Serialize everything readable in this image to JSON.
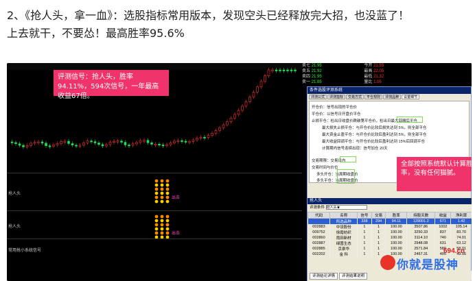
{
  "article": {
    "line1": "2、《抢人头，拿一血》：选股指标常用版本，发现空头已经释放完大招，也没蓝了！",
    "line2": "上去就干，不要怂！最高胜率95.6%"
  },
  "callouts": {
    "top": "评测信号：抢人头，胜率94.11%，594次信号，一年最高收益67倍。",
    "right": "全部按照系统默认计算胜率，没有任何猫腻。"
  },
  "chart": {
    "panel1_label": "抢人头",
    "panel2_label": "抢人头",
    "panel3_label": "常用抢小系统信号",
    "buy_marker": "出击",
    "colors": {
      "up": "#ff3333",
      "down": "#22dd55",
      "bg": "#000000",
      "marker": "#ffcc00",
      "pink": "#ff44cc"
    }
  },
  "quote": {
    "rows": [
      [
        "卖七",
        "21.95",
        "",
        "今开",
        "21.55"
      ],
      [
        "卖五",
        "21.92",
        "",
        "最高",
        "22.05"
      ],
      [
        "卖四",
        "21.95",
        "",
        "最低",
        "21.32"
      ],
      [
        "卖一",
        "21.85",
        "",
        "量比",
        "1.05"
      ]
    ]
  },
  "dialog": {
    "title": "条件选股评测系统",
    "tabs": [
      "评测公式",
      "评测指标",
      "交易方式",
      "平仓规则",
      "评测品种",
      "设置细节"
    ],
    "options": [
      "开仓价：信号出现的平仓价",
      "平仓价：以信号日开盘价平仓",
      "止损平仓：检出日收盘价跌破第平仓价，检出日最大回撤后平仓",
      "最大损失止损平仓：与开仓价比较后损失达到 5%，则全部平仓",
      "最大资金止盈平仓：与开仓价比较后盈利达到 5%，则全部平仓",
      "最大收益回调平仓：与开仓价比较后盈利达到 15%后回调平仓",
      "计算期内信号连续出现：信号加仓 20天",
      "交易期限：交易日内",
      "交易时间与价位",
      "多头开仓：当周期收盘价",
      "多头平仓：当周期收盘价",
      "空头开仓：当周期收盘价",
      "空头平仓：当周期收盘价"
    ],
    "results_title": "抢人头",
    "formula_label": "评测条件",
    "formula_value": "抢人头★",
    "columns": [
      "代码",
      "名称",
      "信号",
      "交易",
      "胜率",
      "持股天数",
      "收益",
      "净利率"
    ],
    "rows": [
      [
        "",
        "所选品种",
        "338",
        "294",
        "94.11",
        "129001.2",
        "671",
        "1.42"
      ],
      [
        "002883",
        "中设股份",
        "1",
        "1",
        "100.00",
        "3507.86",
        "1002",
        "105.14"
      ],
      [
        "009752",
        "徐霞纺织",
        "1",
        "1",
        "100.00",
        "3250.33",
        "837",
        "83.70"
      ],
      [
        "002860",
        "雨田新材",
        "1",
        "1",
        "100.00",
        "3114.10",
        "740",
        "74.01"
      ],
      [
        "002887",
        "绿茵生态",
        "1",
        "1",
        "100.00",
        "2948.08",
        "631",
        "63.12"
      ],
      [
        "002885",
        "京泉华",
        "1",
        "1",
        "100.00",
        "2571.84",
        "580",
        "58.01"
      ],
      [
        "002202",
        "金 科",
        "1",
        "1",
        "100.00",
        "2467.31",
        "495",
        "49.56"
      ]
    ],
    "bottom_tabs": [
      "评测结论详情",
      "评测结果说明"
    ]
  },
  "watermark": {
    "brand": "你就是股神",
    "site": "694.cn"
  }
}
